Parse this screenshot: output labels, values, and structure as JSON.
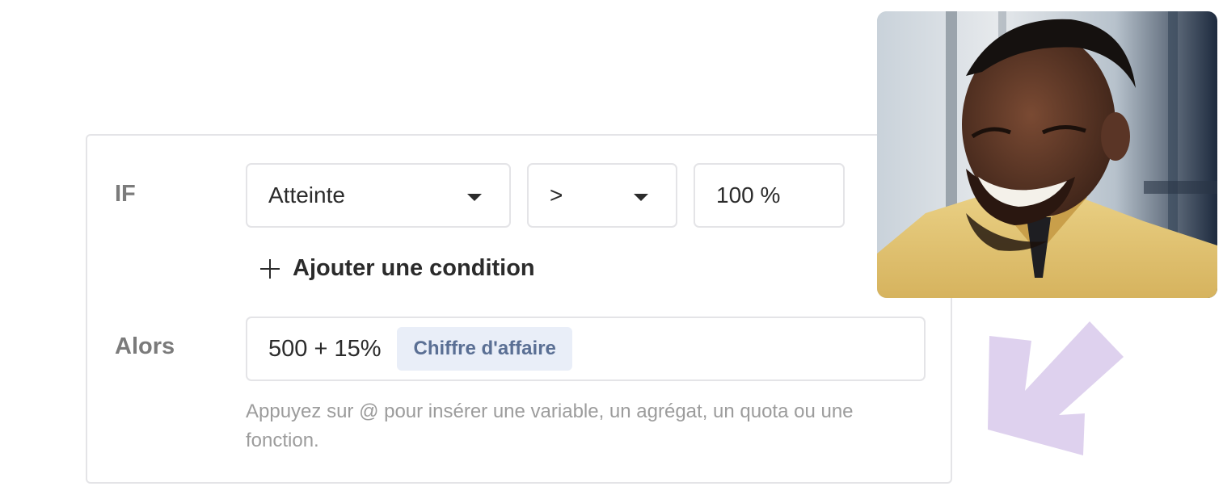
{
  "condition": {
    "if_label": "IF",
    "metric_value": "Atteinte",
    "operator_value": ">",
    "threshold_value": "100 %",
    "add_condition_label": "Ajouter une condition"
  },
  "action": {
    "then_label": "Alors",
    "formula_text": "500 + 15%",
    "variable_chip": "Chiffre d'affaire",
    "hint": "Appuyez sur @ pour insérer une variable, un agrégat, un quota ou une fonction."
  },
  "icons": {
    "add": "plus-icon",
    "dropdown": "caret-down-icon",
    "decoration": "arrow-down-left-icon"
  },
  "colors": {
    "chip_background": "#e9eef8",
    "chip_text": "#5a6f94",
    "arrow": "#ded1ee",
    "label": "#7b7b7b",
    "border": "#e4e4e7"
  }
}
